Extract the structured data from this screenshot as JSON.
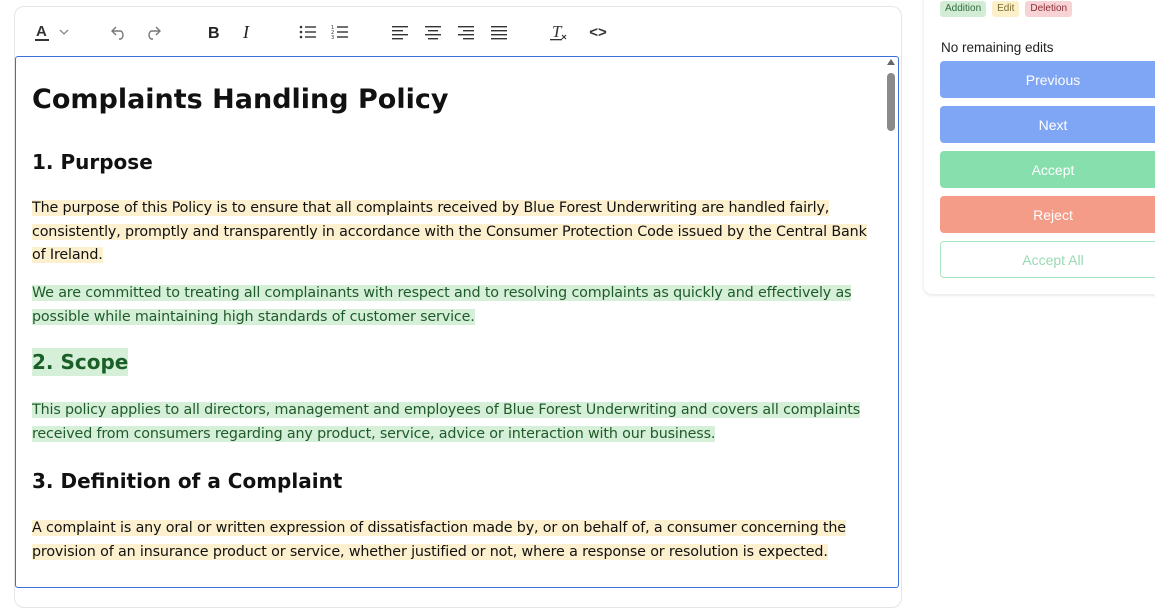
{
  "toolbar": {
    "code_label": "<>"
  },
  "document": {
    "title": "Complaints Handling Policy",
    "sections": [
      {
        "heading": "1. Purpose",
        "paragraphs": [
          "The purpose of this Policy is to ensure that all complaints received by Blue Forest Underwriting are handled fairly, consistently, promptly and transparently in accordance with the Consumer Protection Code issued by the Central Bank of Ireland.",
          "We are committed to treating all complainants with respect and to resolving complaints as quickly and effectively as possible while maintaining high standards of customer service."
        ]
      },
      {
        "heading": "2. Scope",
        "paragraphs": [
          "This policy applies to all directors, management and employees of Blue Forest Underwriting and covers all complaints received from consumers regarding any product, service, advice or interaction with our business."
        ]
      },
      {
        "heading": "3. Definition of a Complaint",
        "paragraphs": [
          "A complaint is any oral or written expression of dissatisfaction made by, or on behalf of, a consumer concerning the provision of an insurance product or service, whether justified or not, where a response or resolution is expected."
        ]
      }
    ]
  },
  "panel": {
    "legend": {
      "addition": "Addition",
      "edit": "Edit",
      "deletion": "Deletion"
    },
    "status": "No remaining edits",
    "buttons": {
      "previous": "Previous",
      "next": "Next",
      "accept": "Accept",
      "reject": "Reject",
      "accept_all": "Accept All"
    }
  },
  "colors": {
    "addition": "#d6efd9",
    "edit": "#fdf0cf",
    "deletion": "#f8d3d6",
    "accent_blue": "#7fa6f4",
    "accept_green": "#87dfae",
    "reject_red": "#f59c88",
    "editor_border": "#3b6fd6"
  }
}
